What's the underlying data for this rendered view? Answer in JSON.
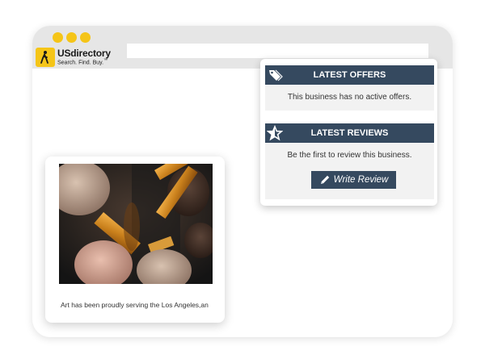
{
  "brand": {
    "name": "USdirectory",
    "tagline": "Search. Find. Buy.",
    "trademark": "™",
    "accent_color": "#f5c518"
  },
  "offers": {
    "title": "LATEST OFFERS",
    "icon": "price-tag-icon",
    "message": "This business has no active offers."
  },
  "reviews": {
    "title": "LATEST REVIEWS",
    "icon": "star-icon",
    "message": "Be the first to review this business.",
    "button_label": "Write Review",
    "button_icon": "pencil-icon"
  },
  "listing": {
    "image": "makeup-brushes-photo",
    "description": "Art  has been proudly serving the Los Angeles,an"
  },
  "colors": {
    "header_bg": "#35495f",
    "section_bg": "#f2f2f2",
    "arrow": "#f2c417"
  }
}
